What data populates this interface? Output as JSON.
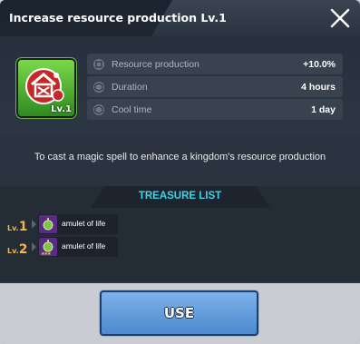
{
  "dialog": {
    "title": "Increase resource production Lv.1",
    "skill_level_badge": "Lv.1",
    "stats": [
      {
        "icon": "resource-icon",
        "label": "Resource production",
        "value": "+10.0%"
      },
      {
        "icon": "duration-icon",
        "label": "Duration",
        "value": "4 hours"
      },
      {
        "icon": "cooltime-icon",
        "label": "Cool time",
        "value": "1 day"
      }
    ],
    "description": "To cast a magic spell to enhance a kingdom's resource production",
    "treasure": {
      "title": "TREASURE LIST",
      "items": [
        {
          "lv_prefix": "Lv.",
          "lv": "1",
          "name": "amulet of life",
          "stars": ""
        },
        {
          "lv_prefix": "Lv.",
          "lv": "2",
          "name": "amulet of life",
          "stars": "★★★"
        }
      ]
    },
    "use_label": "USE",
    "colors": {
      "accent": "#39d4e8",
      "button": "#5d97da",
      "level": "#f0b64a"
    }
  }
}
